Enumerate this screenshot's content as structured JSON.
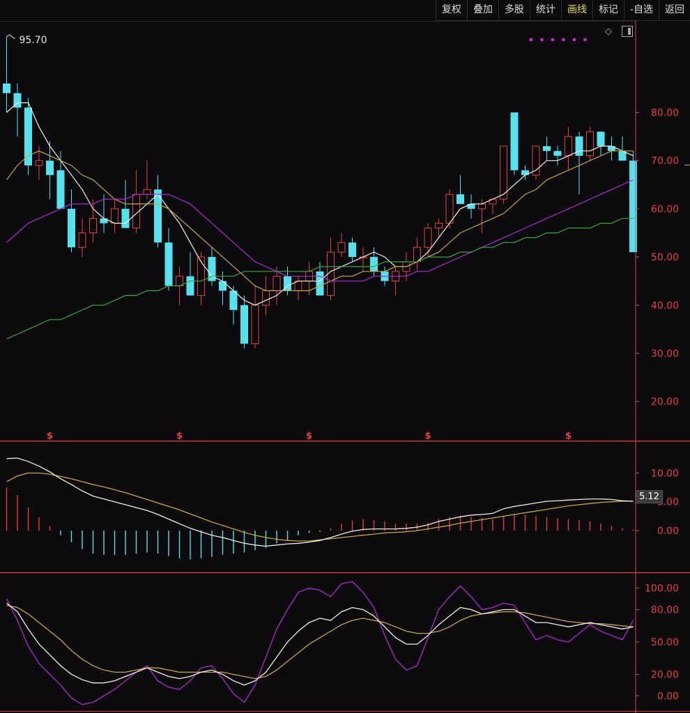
{
  "toolbar": {
    "buttons": [
      {
        "label": "复权",
        "active": false
      },
      {
        "label": "叠加",
        "active": false
      },
      {
        "label": "多股",
        "active": false
      },
      {
        "label": "统计",
        "active": false
      },
      {
        "label": "画线",
        "active": true
      },
      {
        "label": "标记",
        "active": false
      },
      {
        "label": "-自选",
        "active": false
      },
      {
        "label": "返回",
        "active": false
      }
    ]
  },
  "colors": {
    "up": "#e8413a",
    "down": "#54e3ee",
    "ma5": "#f0f0f0",
    "ma10": "#c8a83a",
    "ma20": "#b02ad0",
    "ma60": "#38a838",
    "axis": "#e8413a",
    "grid": "#3a0c0c"
  },
  "icons": [
    "diamond-icon",
    "layout-square-icon",
    "dots-indicator-icon"
  ],
  "chart_data": [
    {
      "type": "candlestick",
      "high_label": "95.70",
      "current_marker_label": "5.12",
      "ylim": [
        12,
        99
      ],
      "y_ticks": [
        "80.00",
        "70.00",
        "60.00",
        "50.00",
        "40.00",
        "30.00",
        "20.00"
      ],
      "y_tick_values": [
        80,
        70,
        60,
        50,
        40,
        30,
        20
      ],
      "dividend_marker": "$",
      "dividend_marker_indices": [
        4,
        16,
        28,
        39,
        52
      ],
      "ohlc": [
        [
          86,
          95.7,
          80,
          84
        ],
        [
          84,
          86,
          75,
          81
        ],
        [
          81,
          83,
          67,
          69
        ],
        [
          69,
          73,
          66,
          70
        ],
        [
          70,
          74,
          62,
          67
        ],
        [
          68,
          72,
          60,
          60
        ],
        [
          60,
          64,
          51,
          52
        ],
        [
          52,
          58,
          50,
          55
        ],
        [
          55,
          62,
          53,
          58
        ],
        [
          58,
          63,
          55,
          57
        ],
        [
          57,
          62,
          55,
          60
        ],
        [
          60,
          66,
          58,
          56
        ],
        [
          56,
          68,
          55,
          63
        ],
        [
          63,
          70,
          62,
          64
        ],
        [
          64,
          67,
          52,
          53
        ],
        [
          53,
          56,
          43,
          44
        ],
        [
          44,
          48,
          40,
          46
        ],
        [
          46,
          51,
          43,
          42
        ],
        [
          42,
          51,
          40,
          50
        ],
        [
          50,
          52,
          44,
          45
        ],
        [
          45,
          47,
          40,
          43
        ],
        [
          43,
          44,
          36,
          39
        ],
        [
          40,
          42,
          31,
          32
        ],
        [
          32,
          44,
          31,
          40
        ],
        [
          40,
          46,
          38,
          43
        ],
        [
          43,
          48,
          40,
          46
        ],
        [
          46,
          48,
          42,
          43
        ],
        [
          43,
          46,
          41,
          45
        ],
        [
          45,
          49,
          42,
          47
        ],
        [
          47,
          49,
          42,
          42
        ],
        [
          42,
          54,
          41,
          51
        ],
        [
          51,
          55,
          50,
          53
        ],
        [
          53,
          54,
          49,
          50
        ],
        [
          50,
          52,
          47,
          50
        ],
        [
          50,
          52,
          46,
          47
        ],
        [
          47,
          48,
          44,
          45
        ],
        [
          45,
          48,
          42,
          47
        ],
        [
          47,
          51,
          45,
          49
        ],
        [
          49,
          54,
          47,
          52
        ],
        [
          52,
          57,
          50,
          56
        ],
        [
          56,
          58,
          54,
          57
        ],
        [
          57,
          64,
          56,
          63
        ],
        [
          63,
          67,
          61,
          61
        ],
        [
          61,
          63,
          58,
          60
        ],
        [
          60,
          62,
          55,
          61
        ],
        [
          61,
          62,
          59,
          62
        ],
        [
          62,
          73,
          61,
          73
        ],
        [
          80,
          80,
          67,
          68
        ],
        [
          68,
          69,
          66,
          67
        ],
        [
          67,
          73,
          66,
          73
        ],
        [
          73,
          75,
          70,
          72
        ],
        [
          72,
          73,
          69,
          71
        ],
        [
          71,
          77,
          68,
          75
        ],
        [
          75,
          76,
          63,
          71
        ],
        [
          71,
          77,
          70,
          76
        ],
        [
          76,
          76,
          71,
          73
        ],
        [
          73,
          75,
          70,
          72
        ],
        [
          72,
          75,
          70,
          70
        ],
        [
          70,
          72,
          51,
          51
        ]
      ],
      "ma_series": [
        {
          "key": "ma5",
          "values": [
            80,
            82,
            82,
            77,
            73,
            70,
            67,
            64,
            60,
            58,
            57,
            57,
            59,
            61,
            63,
            60,
            57,
            53,
            49,
            46,
            45,
            43,
            41,
            40,
            41,
            42,
            44,
            45,
            45,
            45,
            47,
            48,
            49,
            50,
            51,
            50,
            48,
            48,
            49,
            51,
            54,
            57,
            60,
            61,
            61,
            62,
            63,
            65,
            67,
            68,
            70,
            70,
            71,
            72,
            72,
            73,
            73,
            72,
            71
          ]
        },
        {
          "key": "ma10",
          "values": [
            66,
            69,
            71,
            72,
            71,
            70,
            69,
            67,
            66,
            64,
            62,
            61,
            61,
            61,
            61,
            60,
            58,
            56,
            54,
            52,
            50,
            48,
            46,
            44,
            43,
            43,
            43,
            43,
            43,
            44,
            45,
            46,
            46,
            47,
            47,
            47,
            48,
            48,
            49,
            50,
            51,
            53,
            55,
            56,
            57,
            58,
            59,
            61,
            63,
            64,
            66,
            67,
            68,
            69,
            70,
            71,
            72,
            72,
            72
          ]
        },
        {
          "key": "ma20",
          "values": [
            53,
            55,
            57,
            58,
            59,
            60,
            61,
            61,
            61,
            62,
            62,
            62,
            63,
            63,
            63,
            63,
            62,
            61,
            59,
            57,
            55,
            53,
            51,
            49,
            48,
            47,
            46,
            46,
            46,
            46,
            45,
            45,
            45,
            45,
            46,
            46,
            46,
            46,
            47,
            47,
            48,
            49,
            50,
            51,
            52,
            53,
            54,
            55,
            56,
            57,
            58,
            59,
            60,
            61,
            62,
            63,
            64,
            65,
            66
          ]
        },
        {
          "key": "ma60",
          "values": [
            33,
            34,
            35,
            36,
            37,
            37,
            38,
            39,
            40,
            40,
            41,
            42,
            42,
            43,
            43,
            44,
            44,
            45,
            45,
            46,
            46,
            46,
            47,
            47,
            47,
            47,
            47,
            47,
            47,
            48,
            48,
            48,
            48,
            48,
            48,
            49,
            49,
            49,
            49,
            50,
            50,
            50,
            51,
            51,
            52,
            52,
            53,
            53,
            54,
            54,
            55,
            55,
            56,
            56,
            56,
            57,
            57,
            58,
            58
          ]
        }
      ]
    },
    {
      "type": "macd",
      "ylim": [
        -7,
        15
      ],
      "y_ticks": [
        "10.00",
        "5.00",
        "0.00"
      ],
      "y_tick_values": [
        10,
        5,
        0
      ],
      "current_value": 5.12,
      "dif": [
        12.5,
        12.6,
        12.0,
        11.2,
        10.2,
        9.0,
        8.0,
        6.9,
        6.0,
        5.5,
        5.0,
        4.5,
        4.0,
        3.5,
        2.8,
        2.0,
        1.2,
        0.4,
        -0.2,
        -0.8,
        -1.2,
        -1.7,
        -2.2,
        -2.5,
        -2.7,
        -2.5,
        -2.3,
        -2.2,
        -2.0,
        -1.7,
        -1.2,
        -0.6,
        -0.1,
        0.2,
        0.3,
        0.3,
        0.3,
        0.4,
        0.6,
        1.0,
        1.6,
        2.0,
        2.4,
        2.7,
        2.8,
        3.0,
        3.8,
        4.2,
        4.5,
        4.8,
        5.1,
        5.2,
        5.3,
        5.4,
        5.5,
        5.5,
        5.4,
        5.2,
        5.1
      ],
      "dea": [
        8.5,
        9.5,
        10.0,
        10.0,
        9.8,
        9.4,
        9.0,
        8.5,
        8.0,
        7.6,
        7.1,
        6.6,
        6.0,
        5.4,
        4.8,
        4.2,
        3.6,
        2.9,
        2.2,
        1.5,
        0.9,
        0.3,
        -0.3,
        -0.8,
        -1.2,
        -1.5,
        -1.7,
        -1.8,
        -1.8,
        -1.6,
        -1.4,
        -1.2,
        -1.0,
        -0.8,
        -0.6,
        -0.4,
        -0.3,
        -0.2,
        0.0,
        0.3,
        0.6,
        0.9,
        1.3,
        1.6,
        1.9,
        2.2,
        2.5,
        2.8,
        3.1,
        3.4,
        3.7,
        4.0,
        4.3,
        4.5,
        4.7,
        4.9,
        5.0,
        5.1,
        5.12
      ],
      "hist": [
        7.5,
        6.2,
        4.0,
        2.3,
        0.8,
        -0.8,
        -2.0,
        -3.2,
        -4.0,
        -4.2,
        -4.2,
        -4.2,
        -4.0,
        -3.8,
        -4.0,
        -4.4,
        -4.8,
        -5.0,
        -4.8,
        -4.6,
        -4.2,
        -4.0,
        -3.8,
        -3.4,
        -3.0,
        -2.2,
        -1.6,
        -0.8,
        -0.4,
        -0.2,
        0.4,
        1.2,
        1.8,
        2.0,
        1.8,
        1.6,
        1.2,
        1.2,
        1.2,
        1.4,
        2.0,
        2.4,
        2.6,
        2.4,
        2.2,
        2.0,
        2.6,
        2.8,
        2.8,
        2.6,
        2.4,
        2.2,
        2.0,
        1.8,
        1.6,
        1.2,
        0.8,
        0.4,
        0.2
      ]
    },
    {
      "type": "kdj",
      "ylim": [
        -12,
        112
      ],
      "y_ticks": [
        "100.00",
        "80.00",
        "50.00",
        "20.00",
        "0.00"
      ],
      "y_tick_values": [
        100,
        80,
        50,
        20,
        0
      ],
      "k": [
        86,
        78,
        62,
        48,
        38,
        28,
        20,
        15,
        12,
        12,
        14,
        18,
        22,
        26,
        22,
        18,
        16,
        18,
        22,
        24,
        20,
        14,
        10,
        14,
        22,
        36,
        50,
        60,
        68,
        72,
        70,
        78,
        82,
        80,
        74,
        64,
        54,
        48,
        48,
        56,
        66,
        74,
        82,
        80,
        76,
        78,
        80,
        80,
        74,
        68,
        68,
        66,
        64,
        66,
        68,
        66,
        64,
        62,
        64
      ],
      "d": [
        84,
        82,
        76,
        68,
        60,
        52,
        42,
        34,
        28,
        24,
        22,
        22,
        24,
        26,
        26,
        24,
        22,
        22,
        22,
        22,
        22,
        20,
        18,
        16,
        18,
        24,
        32,
        40,
        48,
        54,
        60,
        66,
        70,
        72,
        70,
        68,
        64,
        60,
        58,
        58,
        60,
        64,
        70,
        74,
        76,
        77,
        78,
        78,
        77,
        75,
        73,
        71,
        69,
        68,
        67,
        67,
        66,
        65,
        64
      ],
      "j": [
        90,
        70,
        46,
        30,
        20,
        10,
        -2,
        -8,
        -6,
        0,
        6,
        14,
        22,
        28,
        14,
        8,
        6,
        14,
        26,
        28,
        16,
        2,
        -6,
        10,
        36,
        62,
        80,
        96,
        100,
        98,
        92,
        104,
        106,
        96,
        82,
        56,
        34,
        24,
        28,
        54,
        80,
        92,
        102,
        92,
        80,
        82,
        86,
        84,
        68,
        52,
        56,
        52,
        50,
        58,
        66,
        60,
        56,
        52,
        70
      ]
    }
  ]
}
